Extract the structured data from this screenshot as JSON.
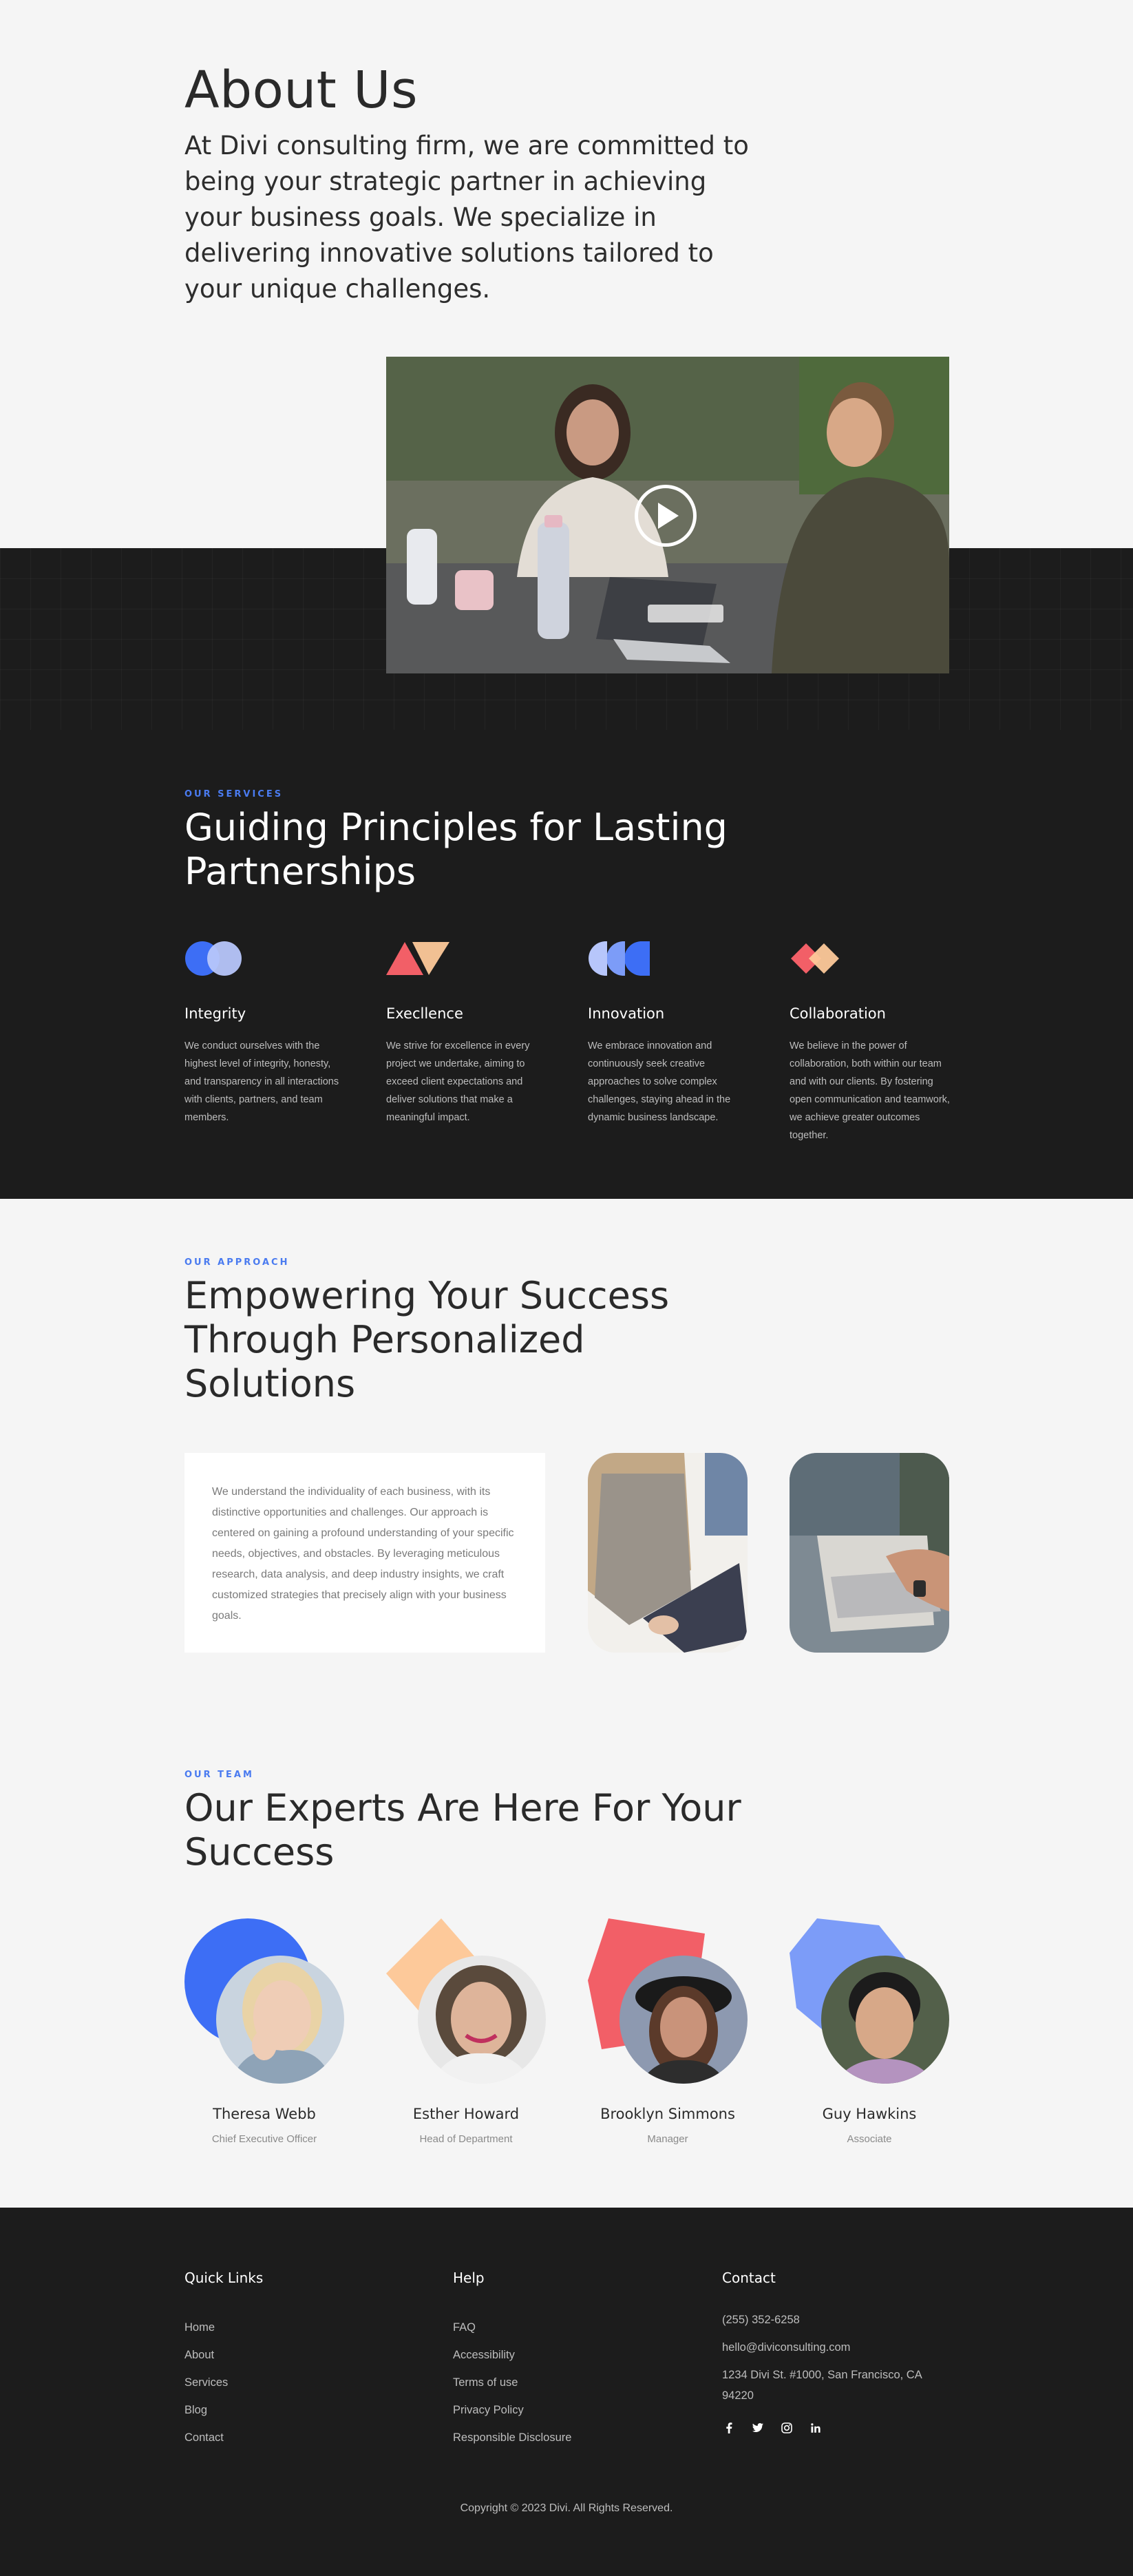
{
  "hero": {
    "title": "About Us",
    "intro": "At Divi consulting firm, we are committed to being your strategic partner in achieving your business goals. We specialize in delivering innovative solutions tailored to your unique challenges."
  },
  "video": {
    "play_icon": "play-icon"
  },
  "services": {
    "eyebrow": "OUR SERVICES",
    "title": "Guiding Principles for Lasting Partnerships",
    "items": [
      {
        "name": "Integrity",
        "desc": "We conduct ourselves with the highest level of integrity, honesty, and transparency in all interactions with clients, partners, and team members.",
        "icon": "integrity-circles-icon"
      },
      {
        "name": "Execllence",
        "desc": "We strive for excellence in every project we undertake, aiming to exceed client expectations and deliver solutions that make a meaningful impact.",
        "icon": "excellence-triangles-icon"
      },
      {
        "name": "Innovation",
        "desc": "We embrace innovation and continuously seek creative approaches to solve complex challenges, staying ahead in the dynamic business landscape.",
        "icon": "innovation-halfcircles-icon"
      },
      {
        "name": "Collaboration",
        "desc": "We believe in the power of collaboration, both within our team and with our clients. By fostering open communication and teamwork, we achieve greater outcomes together.",
        "icon": "collaboration-diamonds-icon"
      }
    ]
  },
  "approach": {
    "eyebrow": "OUR APPROACH",
    "title": "Empowering Your Success Through Personalized Solutions",
    "body": "We understand the individuality of each business, with its distinctive opportunities and challenges. Our approach is centered on gaining a profound understanding of your specific needs, objectives, and obstacles. By leveraging meticulous research, data analysis, and deep industry insights, we craft customized strategies that precisely align with your business goals."
  },
  "team": {
    "eyebrow": "OUR TEAM",
    "title": "Our Experts Are Here For Your Success",
    "members": [
      {
        "name": "Theresa Webb",
        "role": "Chief Executive Officer"
      },
      {
        "name": "Esther Howard",
        "role": "Head of Department"
      },
      {
        "name": "Brooklyn Simmons",
        "role": "Manager"
      },
      {
        "name": "Guy Hawkins",
        "role": "Associate"
      }
    ]
  },
  "footer": {
    "quick_links": {
      "title": "Quick Links",
      "items": [
        "Home",
        "About",
        "Services",
        "Blog",
        "Contact"
      ]
    },
    "help": {
      "title": "Help",
      "items": [
        "FAQ",
        "Accessibility",
        "Terms of use",
        "Privacy Policy",
        "Responsible Disclosure"
      ]
    },
    "contact": {
      "title": "Contact",
      "phone": "(255) 352-6258",
      "email": "hello@diviconsulting.com",
      "address": "1234 Divi St. #1000, San Francisco, CA 94220"
    },
    "social": {
      "facebook": "f",
      "twitter": "t",
      "instagram": "ig",
      "linkedin": "in"
    },
    "copyright": "Copyright © 2023 Divi. All Rights Reserved."
  },
  "colors": {
    "accent_blue": "#4a7bf0",
    "dark": "#1c1c1c",
    "light": "#f5f5f5",
    "coral": "#f25f67",
    "peach": "#fdc99a"
  }
}
